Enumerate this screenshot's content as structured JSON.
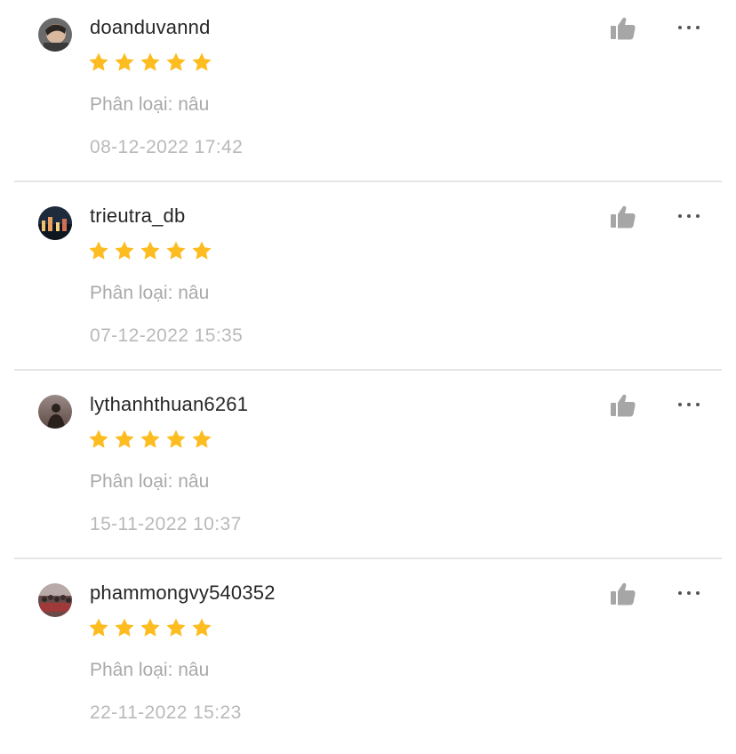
{
  "colors": {
    "star": "#FDBC1F",
    "username": "#262626",
    "muted": "#A9A9A9",
    "icon": "#A6A6A6"
  },
  "reviews": [
    {
      "username": "doanduvannd",
      "rating": 5,
      "variant": "Phân loại: nâu",
      "date": "08-12-2022 17:42",
      "avatar": "avatar-photo"
    },
    {
      "username": "trieutra_db",
      "rating": 5,
      "variant": "Phân loại: nâu",
      "date": "07-12-2022 15:35",
      "avatar": "avatar-photo"
    },
    {
      "username": "lythanhthuan6261",
      "rating": 5,
      "variant": "Phân loại: nâu",
      "date": "15-11-2022 10:37",
      "avatar": "avatar-photo"
    },
    {
      "username": "phammongvy540352",
      "rating": 5,
      "variant": "Phân loại: nâu",
      "date": "22-11-2022 15:23",
      "avatar": "avatar-photo"
    }
  ],
  "icons": {
    "like": "thumbs-up-icon",
    "more": "more-options-icon",
    "star": "star-icon"
  }
}
